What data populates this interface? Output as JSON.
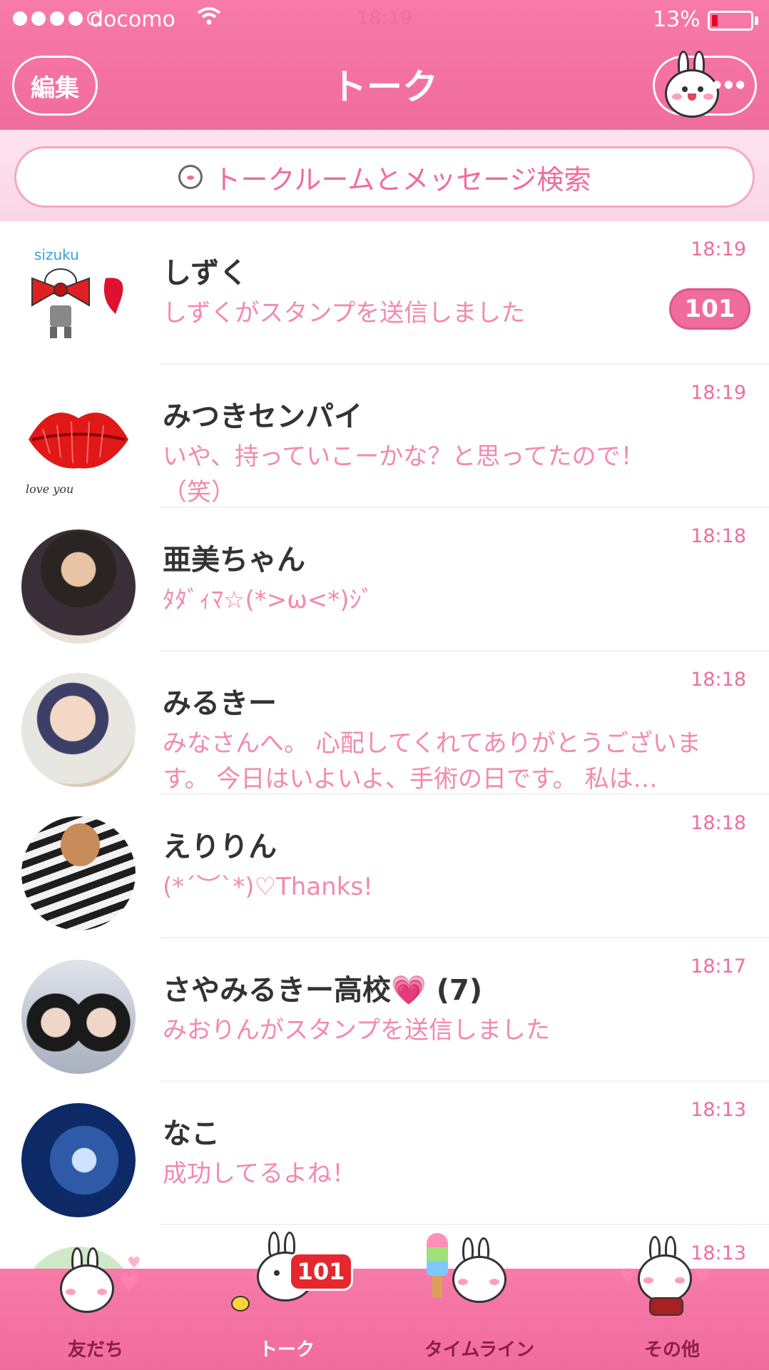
{
  "status_bar": {
    "carrier": "docomo",
    "time": "18:19",
    "battery_percent": "13%",
    "battery_level": 0.13,
    "signal_bars": 4,
    "wifi_icon": "wifi-icon"
  },
  "header": {
    "edit_label": "編集",
    "title": "トーク",
    "more_icon": "ellipsis-icon"
  },
  "search": {
    "placeholder": "トークルームとメッセージ検索",
    "icon": "bunny-search-icon"
  },
  "colors": {
    "accent": "#f06c9c",
    "preview_text": "#f389ad",
    "badge": "#f06c9c",
    "tab_badge": "#e3282f"
  },
  "talks": [
    {
      "name": "しずく",
      "preview": "しずくがスタンプを送信しました",
      "time": "18:19",
      "unread": "101",
      "avatar_caption": "sizuku"
    },
    {
      "name": "みつきセンパイ",
      "preview": "いや、持っていこーかな？と思ってたので！（笑）",
      "time": "18:19",
      "avatar_caption": "love you"
    },
    {
      "name": "亜美ちゃん",
      "preview": "ﾀﾀﾞｨﾏ☆(*>ω<*)ｼﾞ",
      "time": "18:18"
    },
    {
      "name": "みるきー",
      "preview": "みなさんへ。 心配してくれてありがとうございます。 今日はいよいよ、手術の日です。 私は…",
      "time": "18:18"
    },
    {
      "name": "えりりん",
      "preview": "(*´︶`*)♡Thanks!",
      "time": "18:18"
    },
    {
      "name": "さやみるきー高校",
      "member_count": "(7)",
      "preview": "みおりんがスタンプを送信しました",
      "time": "18:17"
    },
    {
      "name": "なこ",
      "preview": "成功してるよね！",
      "time": "18:13"
    },
    {
      "name": "",
      "preview": "",
      "time": "18:13"
    }
  ],
  "tabs": [
    {
      "label": "友だち",
      "icon": "friends-bunny-icon"
    },
    {
      "label": "トーク",
      "icon": "talk-bunny-icon",
      "badge": "101",
      "active": true
    },
    {
      "label": "タイムライン",
      "icon": "timeline-bunny-icon"
    },
    {
      "label": "その他",
      "icon": "more-bunny-icon"
    }
  ]
}
